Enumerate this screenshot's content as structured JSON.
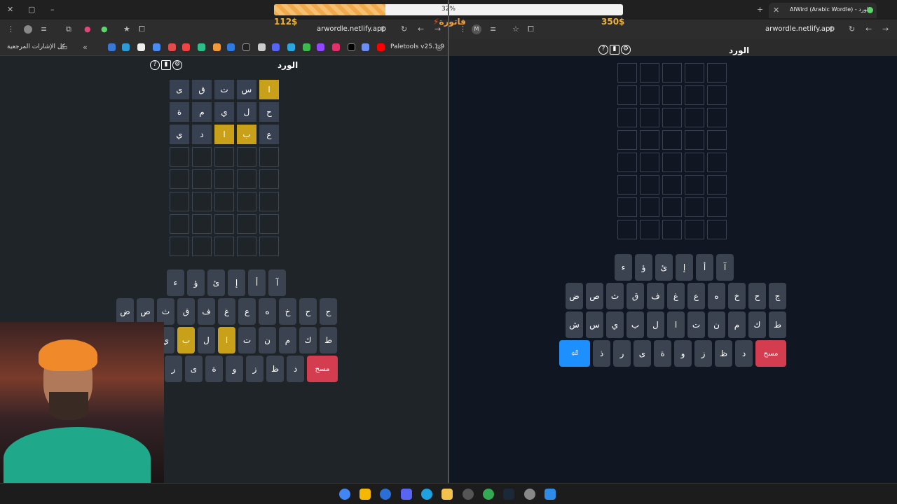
{
  "left_browser": {
    "url": "arwordle.netlify.app",
    "bookmarks_all_label": "كل الإشارات المرجعية",
    "paletools_label": "Paletools v25.1.9"
  },
  "right_browser": {
    "tab_title": "AlWird (Arabic Wordle) - الورد",
    "url": "arwordle.netlify.app",
    "profile_letter": "M"
  },
  "overlay": {
    "progress_label": "32%",
    "progress_fraction": 0.32,
    "money_left": "112$",
    "money_right": "350$",
    "bill_label": "فاتورة"
  },
  "left_game": {
    "title": "الورد",
    "rows": [
      [
        {
          "c": "ا",
          "s": "gold"
        },
        {
          "c": "س",
          "s": "filled"
        },
        {
          "c": "ت",
          "s": "filled"
        },
        {
          "c": "ق",
          "s": "filled"
        },
        {
          "c": "ى",
          "s": "filled"
        }
      ],
      [
        {
          "c": "ح",
          "s": "filled"
        },
        {
          "c": "ل",
          "s": "filled"
        },
        {
          "c": "ي",
          "s": "filled"
        },
        {
          "c": "م",
          "s": "filled"
        },
        {
          "c": "ة",
          "s": "filled"
        }
      ],
      [
        {
          "c": "ع",
          "s": "filled"
        },
        {
          "c": "ب",
          "s": "gold"
        },
        {
          "c": "ا",
          "s": "gold"
        },
        {
          "c": "د",
          "s": "filled"
        },
        {
          "c": "ي",
          "s": "filled"
        }
      ]
    ],
    "keyboard": {
      "row1": [
        "آ",
        "أ",
        "إ",
        "ئ",
        "ؤ",
        "ء"
      ],
      "row2": [
        "ج",
        "ح",
        "خ",
        "ه",
        "ع",
        "غ",
        "ف",
        "ق",
        "ث",
        "ص",
        "ض"
      ],
      "row3": [
        "ط",
        "ك",
        "م",
        "ن",
        "ت",
        "ا",
        "ل",
        "ب",
        "ي"
      ],
      "row4": [
        "مسح",
        "د",
        "ظ",
        "ز",
        "و",
        "ة",
        "ى",
        "ر"
      ],
      "gold_keys": [
        "ا",
        "ب"
      ]
    }
  },
  "right_game": {
    "title": "الورد",
    "keyboard": {
      "row1": [
        "آ",
        "أ",
        "إ",
        "ئ",
        "ؤ",
        "ء"
      ],
      "row2": [
        "ج",
        "ح",
        "خ",
        "ه",
        "ع",
        "غ",
        "ف",
        "ق",
        "ث",
        "ص",
        "ض"
      ],
      "row3": [
        "ط",
        "ك",
        "م",
        "ن",
        "ت",
        "ا",
        "ل",
        "ب",
        "ي",
        "س",
        "ش"
      ],
      "row4": [
        "مسح",
        "د",
        "ظ",
        "ز",
        "و",
        "ة",
        "ى",
        "ر",
        "ذ",
        "⏎"
      ]
    }
  },
  "colors": {
    "gold": "#c9a01a",
    "red": "#d43d4f",
    "blue": "#1e8fff",
    "key": "#3b4350"
  }
}
